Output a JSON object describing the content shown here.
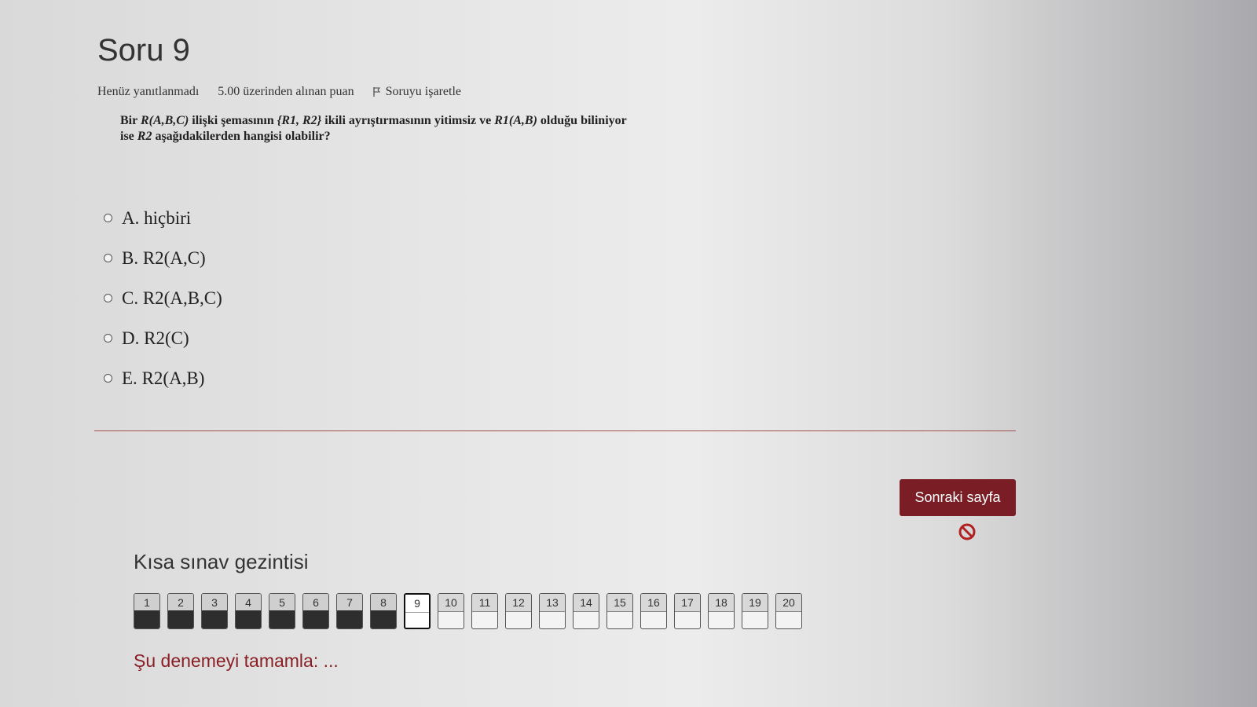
{
  "question": {
    "title": "Soru 9",
    "status": "Henüz yanıtlanmadı",
    "points": "5.00 üzerinden alınan puan",
    "flag_label": "Soruyu işaretle",
    "text_line1_a": "Bir ",
    "text_line1_rel": "R(A,B,C)",
    "text_line1_b": " ilişki şemasının ",
    "text_line1_decomp": "{R1, R2}",
    "text_line1_c": " ikili ayrıştırmasının yitimsiz ve ",
    "text_line1_r1": "R1(A,B)",
    "text_line1_d": " olduğu biliniyor",
    "text_line2_a": "ise ",
    "text_line2_r2": "R2",
    "text_line2_b": " aşağıdakilerden hangisi olabilir?"
  },
  "options": [
    {
      "letter": "A.",
      "text": "hiçbiri"
    },
    {
      "letter": "B.",
      "text": "R2(A,C)"
    },
    {
      "letter": "C.",
      "text": "R2(A,B,C)"
    },
    {
      "letter": "D.",
      "text": "R2(C)"
    },
    {
      "letter": "E.",
      "text": "R2(A,B)"
    }
  ],
  "buttons": {
    "next": "Sonraki sayfa"
  },
  "navigation": {
    "title": "Kısa sınav gezintisi",
    "current": 9,
    "answered_count": 8,
    "questions": [
      "1",
      "2",
      "3",
      "4",
      "5",
      "6",
      "7",
      "8",
      "9",
      "10",
      "11",
      "12",
      "13",
      "14",
      "15",
      "16",
      "17",
      "18",
      "19",
      "20"
    ],
    "finish_link": "Şu denemeyi tamamla: ..."
  },
  "colors": {
    "accent": "#7b1d24",
    "link": "#8a1f25",
    "answered": "#2e2e2e"
  }
}
